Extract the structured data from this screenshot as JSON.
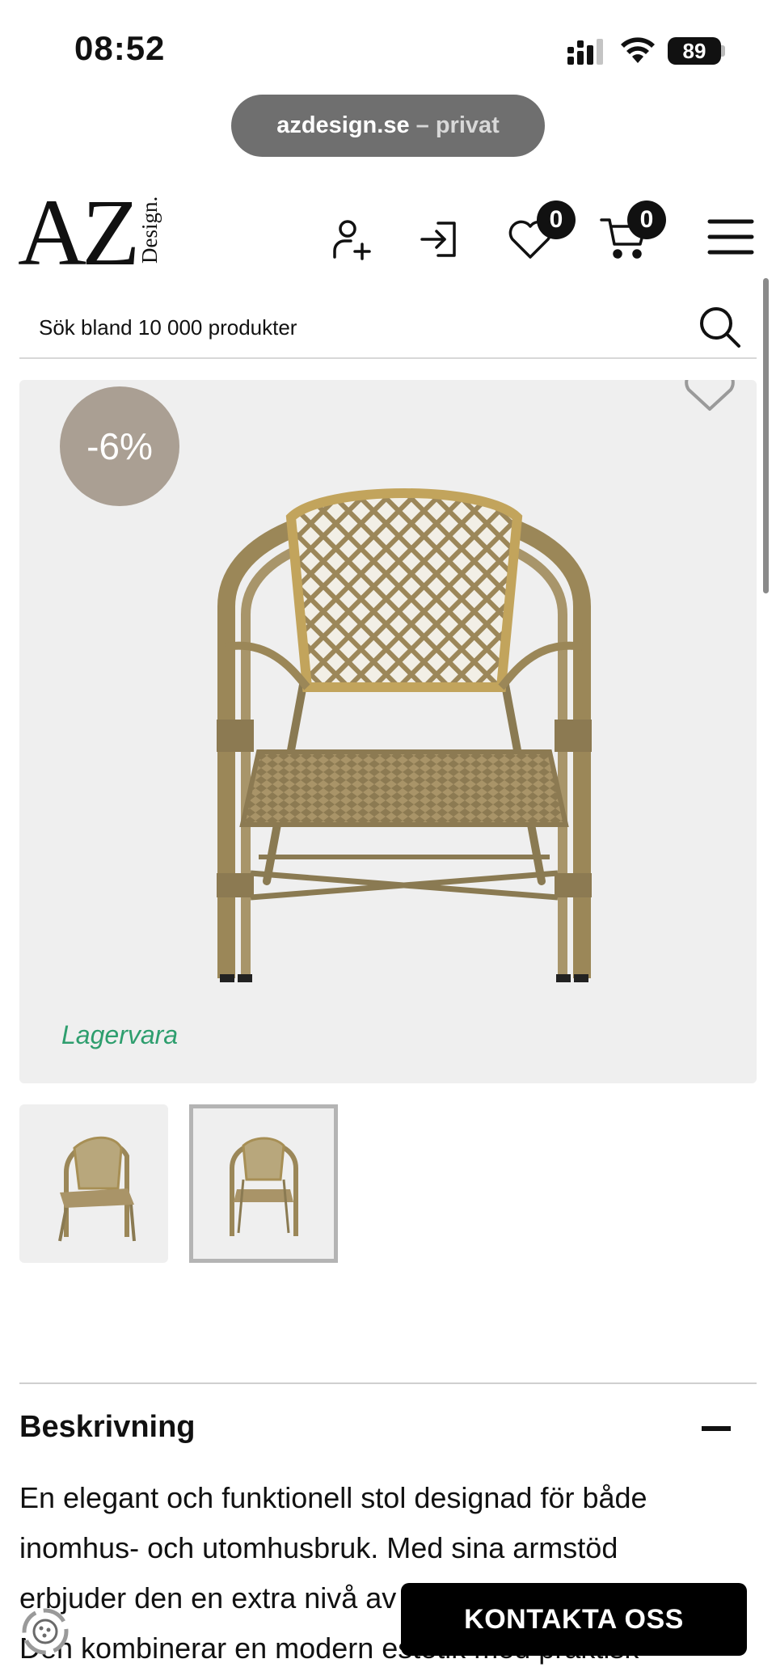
{
  "status_bar": {
    "time": "08:52",
    "battery": "89"
  },
  "browser": {
    "url_domain": "azdesign.se",
    "url_suffix": " – privat"
  },
  "header": {
    "logo_main": "AZ",
    "logo_sub": "Design.",
    "wishlist_count": "0",
    "cart_count": "0",
    "icons": [
      "user-add-icon",
      "login-icon",
      "heart-icon",
      "cart-icon",
      "menu-icon"
    ]
  },
  "search": {
    "placeholder": "Sök bland 10 000 produkter"
  },
  "product": {
    "discount": "-6%",
    "stock_status": "Lagervara",
    "stock_color": "#2e9e6e",
    "discount_color": "#aa9f93",
    "thumbnails": [
      "chair-angled",
      "chair-front"
    ],
    "selected_thumbnail": 2
  },
  "description": {
    "title": "Beskrivning",
    "lines": [
      "En elegant och funktionell stol designad för både",
      "inomhus- och utomhusbruk. Med sina armstöd",
      "erbjuder den en extra nivå av",
      "Den kombinerar en modern estetik med praktisk"
    ]
  },
  "floating": {
    "contact_label": "KONTAKTA OSS"
  }
}
